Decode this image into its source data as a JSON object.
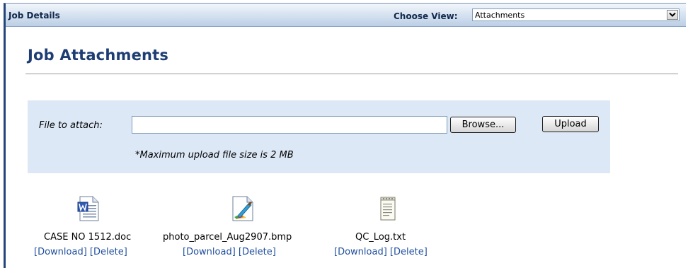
{
  "header": {
    "title": "Job Details",
    "view_label": "Choose View:",
    "view_selected": "Attachments"
  },
  "page": {
    "title": "Job Attachments"
  },
  "upload": {
    "file_label": "File to attach:",
    "file_value": "",
    "browse_label": "Browse...",
    "upload_label": "Upload",
    "size_note": "*Maximum upload file size is 2 MB"
  },
  "attachments": [
    {
      "name": "CASE NO 1512.doc",
      "icon": "word-document-icon",
      "download": "[Download]",
      "delete": "[Delete]"
    },
    {
      "name": "photo_parcel_Aug2907.bmp",
      "icon": "paint-image-icon",
      "download": "[Download]",
      "delete": "[Delete]"
    },
    {
      "name": "QC_Log.txt",
      "icon": "text-file-icon",
      "download": "[Download]",
      "delete": "[Delete]"
    }
  ],
  "colors": {
    "header_text": "#12284d",
    "title": "#1d3d73",
    "panel_bg": "#dde8f7",
    "link": "#1f4f9e",
    "frame": "#24457b"
  }
}
